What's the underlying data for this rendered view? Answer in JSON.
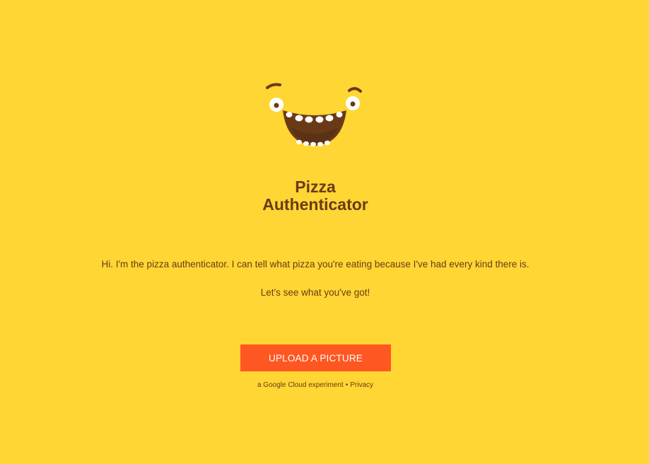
{
  "app": {
    "title_line1": "Pizza",
    "title_line2": "Authenticator",
    "mascot_icon": "smiling-face-icon"
  },
  "main": {
    "intro": "Hi. I'm the pizza authenticator. I can tell what pizza you're eating because I've had every kind there is.",
    "prompt": "Let's see what you've got!",
    "upload_label": "UPLOAD A PICTURE"
  },
  "footer": {
    "experiment_text": "a Google Cloud experiment",
    "separator": "•",
    "privacy_label": "Privacy"
  },
  "colors": {
    "background": "#FFD633",
    "text": "#6A3A17",
    "button": "#FF5722",
    "button_text": "#FFFFFF"
  }
}
